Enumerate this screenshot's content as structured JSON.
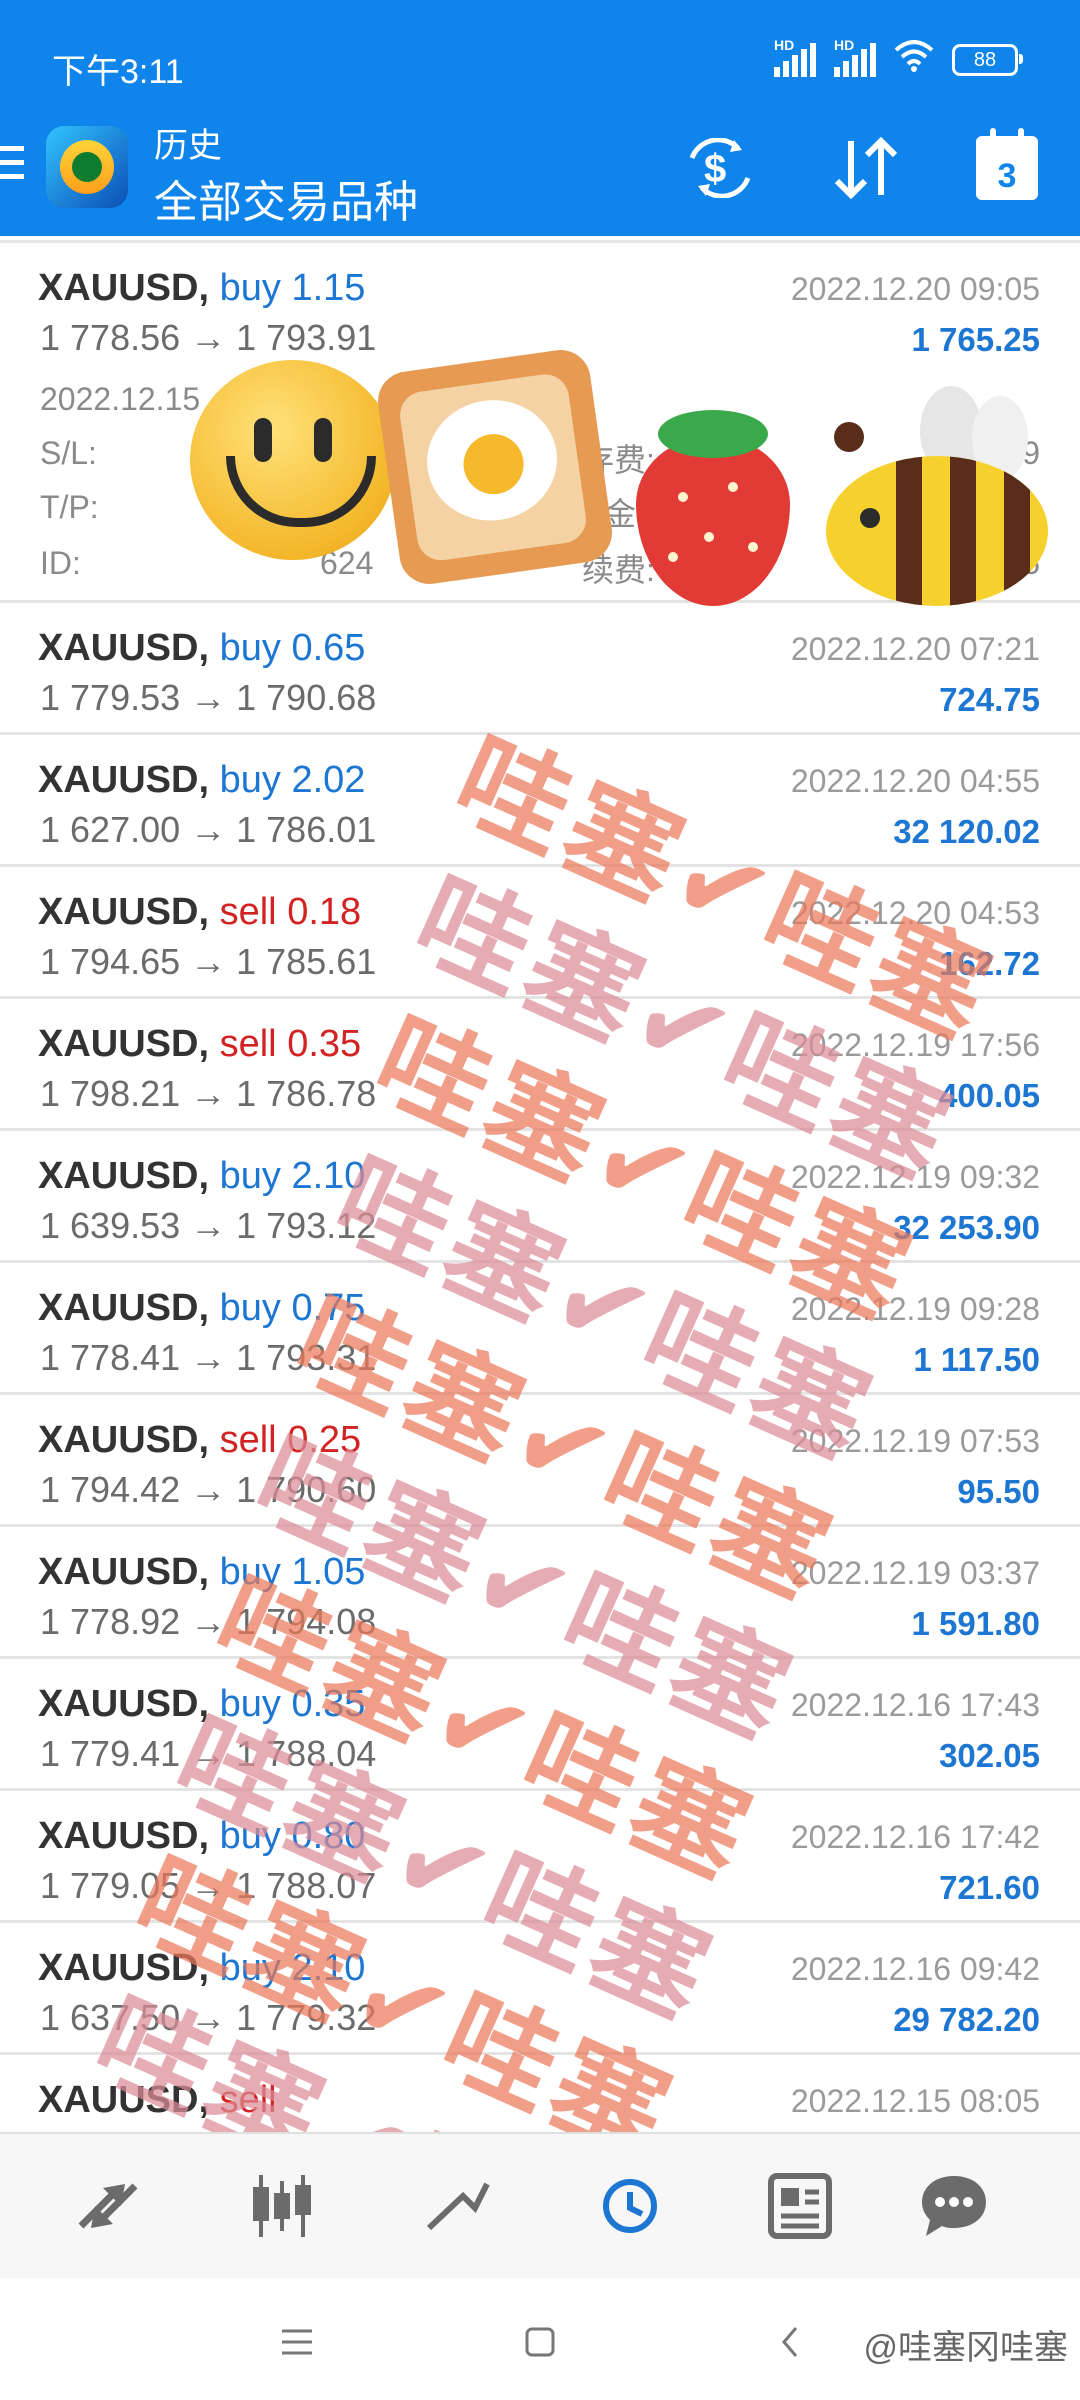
{
  "status_bar": {
    "time": "下午3:11",
    "signal1_label": "HD",
    "signal2_label": "HD",
    "battery": "88"
  },
  "app_bar": {
    "title": "历史",
    "subtitle": "全部交易品种",
    "calendar_day": "3",
    "icons": [
      "menu-icon",
      "app-logo",
      "currency-swap-icon",
      "sort-icon",
      "calendar-icon"
    ]
  },
  "trades": [
    {
      "symbol": "XAUUSD,",
      "type": "buy",
      "volume": "1.15",
      "prices": "1 778.56 → 1 793.91",
      "datetime": "2022.12.20 09:05",
      "profit": "1 765.25"
    },
    {
      "symbol": "XAUUSD,",
      "type": "buy",
      "volume": "0.65",
      "prices": "1 779.53 → 1 790.68",
      "datetime": "2022.12.20 07:21",
      "profit": "724.75"
    },
    {
      "symbol": "XAUUSD,",
      "type": "buy",
      "volume": "2.02",
      "prices": "1 627.00 → 1 786.01",
      "datetime": "2022.12.20 04:55",
      "profit": "32 120.02"
    },
    {
      "symbol": "XAUUSD,",
      "type": "sell",
      "volume": "0.18",
      "prices": "1 794.65 → 1 785.61",
      "datetime": "2022.12.20 04:53",
      "profit": "162.72"
    },
    {
      "symbol": "XAUUSD,",
      "type": "sell",
      "volume": "0.35",
      "prices": "1 798.21 → 1 786.78",
      "datetime": "2022.12.19 17:56",
      "profit": "400.05"
    },
    {
      "symbol": "XAUUSD,",
      "type": "buy",
      "volume": "2.10",
      "prices": "1 639.53 → 1 793.12",
      "datetime": "2022.12.19 09:32",
      "profit": "32 253.90"
    },
    {
      "symbol": "XAUUSD,",
      "type": "buy",
      "volume": "0.75",
      "prices": "1 778.41 → 1 793.31",
      "datetime": "2022.12.19 09:28",
      "profit": "1 117.50"
    },
    {
      "symbol": "XAUUSD,",
      "type": "sell",
      "volume": "0.25",
      "prices": "1 794.42 → 1 790.60",
      "datetime": "2022.12.19 07:53",
      "profit": "95.50"
    },
    {
      "symbol": "XAUUSD,",
      "type": "buy",
      "volume": "1.05",
      "prices": "1 778.92 → 1 794.08",
      "datetime": "2022.12.19 03:37",
      "profit": "1 591.80"
    },
    {
      "symbol": "XAUUSD,",
      "type": "buy",
      "volume": "0.35",
      "prices": "1 779.41 → 1 788.04",
      "datetime": "2022.12.16 17:43",
      "profit": "302.05"
    },
    {
      "symbol": "XAUUSD,",
      "type": "buy",
      "volume": "0.80",
      "prices": "1 779.05 → 1 788.07",
      "datetime": "2022.12.16 17:42",
      "profit": "721.60"
    },
    {
      "symbol": "XAUUSD,",
      "type": "buy",
      "volume": "2.10",
      "prices": "1 637.50 → 1 779.32",
      "datetime": "2022.12.16 09:42",
      "profit": "29 782.20"
    },
    {
      "symbol": "XAUUSD,",
      "type": "sell",
      "volume": "",
      "prices": "",
      "datetime": "2022.12.15 08:05",
      "profit": ""
    }
  ],
  "expanded_details": {
    "open_time": "2022.12.15",
    "sl_label": "S/L:",
    "tp_label": "T/P:",
    "id_label": "ID:",
    "id_value_partial": "624",
    "storage_label_partial": "存费:",
    "tax_label_partial": "金:",
    "commission_label_partial": "续费:",
    "storage_value_partial": "9",
    "commission_value_partial": "5"
  },
  "watermark": {
    "text": "哇塞✔哇塞"
  },
  "bottom_nav": {
    "items": [
      "quotes-icon",
      "chart-icon",
      "trade-icon",
      "history-icon",
      "news-icon",
      "chat-icon"
    ]
  },
  "system_nav": {
    "credit": "@哇塞冈哇塞"
  },
  "colors": {
    "primary": "#0f84ea",
    "buy": "#1c76d2",
    "sell": "#d32222"
  }
}
